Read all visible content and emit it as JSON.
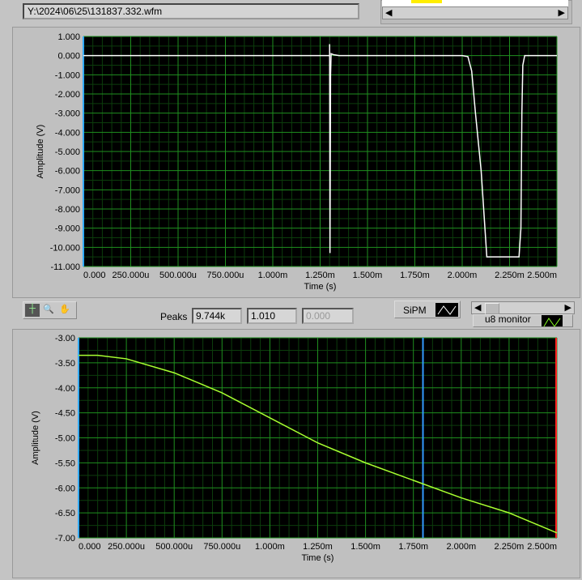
{
  "file_path": "Y:\\2024\\06\\25\\131837.332.wfm",
  "toolbar": {
    "peaks_label": "Peaks",
    "peak_values": [
      "9.744k",
      "1.010",
      "0.000"
    ],
    "sipm_label": "SiPM",
    "u8_label": "u8 monitor"
  },
  "colors": {
    "plot_bg": "#000000",
    "grid_major": "#1f8f1f",
    "grid_minor": "#0c3d0c",
    "trace_top": "#ffffff",
    "trace_bottom": "#a8ff30",
    "cursor": "#3399ff",
    "cursor_end": "#ff2020"
  },
  "chart_data": [
    {
      "type": "line",
      "title": "",
      "xlabel": "Time (s)",
      "ylabel": "Amplitude (V)",
      "xlim": [
        0,
        0.0025
      ],
      "ylim": [
        -11,
        1
      ],
      "xticks": [
        "0.000",
        "250.000u",
        "500.000u",
        "750.000u",
        "1.000m",
        "1.250m",
        "1.500m",
        "1.750m",
        "2.000m",
        "2.250m",
        "2.500m"
      ],
      "yticks": [
        "1.000",
        "0.000",
        "-1.000",
        "-2.000",
        "-3.000",
        "-4.000",
        "-5.000",
        "-6.000",
        "-7.000",
        "-8.000",
        "-9.000",
        "-10.000",
        "-11.000"
      ],
      "ytick_values": [
        1,
        0,
        -1,
        -2,
        -3,
        -4,
        -5,
        -6,
        -7,
        -8,
        -9,
        -10,
        -11
      ],
      "x": [
        0,
        0.0013,
        0.0013,
        0.001302,
        0.001305,
        0.001308,
        0.00132,
        0.00135,
        0.002,
        0.00203,
        0.00205,
        0.00207,
        0.0021,
        0.00212,
        0.00213,
        0.00215,
        0.0023,
        0.00231,
        0.002315,
        0.00232,
        0.00233,
        0.0025
      ],
      "y": [
        0,
        0,
        0.6,
        -10.3,
        -1,
        0.1,
        0.05,
        0,
        0,
        -0.05,
        -0.8,
        -3,
        -6,
        -9,
        -10.5,
        -10.5,
        -10.5,
        -9,
        -3,
        -0.5,
        0,
        0
      ]
    },
    {
      "type": "line",
      "title": "",
      "xlabel": "Time (s)",
      "ylabel": "Amplitude (V)",
      "xlim": [
        0,
        0.0025
      ],
      "ylim": [
        -7,
        -3
      ],
      "xticks": [
        "0.000",
        "250.000u",
        "500.000u",
        "750.000u",
        "1.000m",
        "1.250m",
        "1.500m",
        "1.750m",
        "2.000m",
        "2.250m",
        "2.500m"
      ],
      "yticks": [
        "-3.00",
        "-3.50",
        "-4.00",
        "-4.50",
        "-5.00",
        "-5.50",
        "-6.00",
        "-6.50",
        "-7.00"
      ],
      "ytick_values": [
        -3,
        -3.5,
        -4,
        -4.5,
        -5,
        -5.5,
        -6,
        -6.5,
        -7
      ],
      "x": [
        0,
        0.0001,
        0.00025,
        0.0005,
        0.00075,
        0.001,
        0.00125,
        0.0015,
        0.00175,
        0.002,
        0.00225,
        0.0025
      ],
      "y": [
        -3.35,
        -3.35,
        -3.42,
        -3.7,
        -4.1,
        -4.6,
        -5.1,
        -5.5,
        -5.85,
        -6.2,
        -6.5,
        -6.9
      ],
      "cursor_x": 0.0018
    }
  ]
}
